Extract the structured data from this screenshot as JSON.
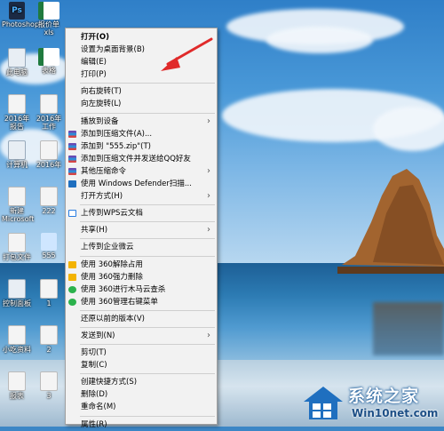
{
  "desktop": {
    "icons": [
      {
        "label": "Photoshop",
        "glyph": "ps"
      },
      {
        "label": "报价单xls",
        "glyph": "xls"
      },
      {
        "label": "此电脑",
        "glyph": "app"
      },
      {
        "label": "表格",
        "glyph": "xls"
      },
      {
        "label": "2016年报告",
        "glyph": "doc"
      },
      {
        "label": "2016年工作",
        "glyph": "doc"
      },
      {
        "label": "计算机",
        "glyph": "app"
      },
      {
        "label": "2016年",
        "glyph": "doc"
      },
      {
        "label": "新建 Microsoft",
        "glyph": "doc"
      },
      {
        "label": "222",
        "glyph": "doc"
      },
      {
        "label": "打包文件",
        "glyph": "doc"
      },
      {
        "label": "555",
        "glyph": "sel"
      },
      {
        "label": "控制面板",
        "glyph": "app"
      },
      {
        "label": "1",
        "glyph": "doc"
      },
      {
        "label": "小吃资料",
        "glyph": "doc"
      },
      {
        "label": "2",
        "glyph": "doc"
      },
      {
        "label": "报表",
        "glyph": "doc"
      },
      {
        "label": "3",
        "glyph": "doc"
      }
    ]
  },
  "context_menu": {
    "items": [
      {
        "label": "打开(O)",
        "bold": true
      },
      {
        "label": "设置为桌面背景(B)"
      },
      {
        "label": "编辑(E)"
      },
      {
        "label": "打印(P)"
      },
      {
        "sep": true
      },
      {
        "label": "向右旋转(T)"
      },
      {
        "label": "向左旋转(L)"
      },
      {
        "sep": true
      },
      {
        "label": "播放到设备",
        "submenu": true
      },
      {
        "label": "添加到压缩文件(A)...",
        "icon": "winrar-icon"
      },
      {
        "label": "添加到 \"555.zip\"(T)",
        "icon": "winrar-icon"
      },
      {
        "label": "添加到压缩文件并发送给QQ好友",
        "icon": "winrar-icon"
      },
      {
        "label": "其他压缩命令",
        "icon": "winrar-icon",
        "submenu": true
      },
      {
        "label": "使用 Windows Defender扫描...",
        "icon": "defender-icon"
      },
      {
        "label": "打开方式(H)",
        "submenu": true
      },
      {
        "sep": true
      },
      {
        "label": "上传到WPS云文档",
        "icon": "wps-cloud-icon"
      },
      {
        "sep": true
      },
      {
        "label": "共享(H)",
        "submenu": true
      },
      {
        "sep": true
      },
      {
        "label": "上传到企业微云"
      },
      {
        "sep": true
      },
      {
        "label": "使用 360解除占用",
        "icon": "360-unlock-icon"
      },
      {
        "label": "使用 360强力删除",
        "icon": "360-delete-icon"
      },
      {
        "label": "使用 360进行木马云查杀",
        "icon": "360-scan-icon"
      },
      {
        "label": "使用 360管理右键菜单",
        "icon": "360-menu-icon"
      },
      {
        "sep": true
      },
      {
        "label": "还原以前的版本(V)"
      },
      {
        "sep": true
      },
      {
        "label": "发送到(N)",
        "submenu": true
      },
      {
        "sep": true
      },
      {
        "label": "剪切(T)"
      },
      {
        "label": "复制(C)"
      },
      {
        "sep": true
      },
      {
        "label": "创建快捷方式(S)"
      },
      {
        "label": "删除(D)"
      },
      {
        "label": "重命名(M)"
      },
      {
        "sep": true
      },
      {
        "label": "属性(R)"
      }
    ],
    "submenu_arrow": "›"
  },
  "watermark": {
    "title": "系统之家",
    "site": "Win10net.com"
  },
  "colors": {
    "annotation_arrow": "#e02a2a",
    "menu_bg": "#f2f2f2"
  }
}
